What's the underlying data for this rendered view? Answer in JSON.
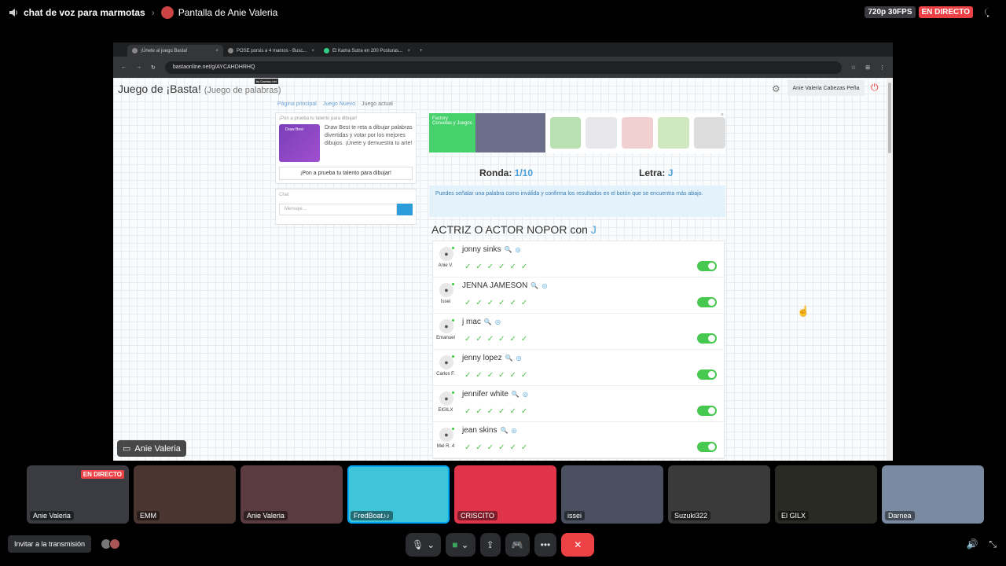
{
  "topbar": {
    "channel": "chat de voz para marmotas",
    "stream_title": "Pantalla de Anie Valeria",
    "quality": "720p 30FPS",
    "live": "EN DIRECTO"
  },
  "browser": {
    "tabs": [
      "¡Únete al juego Basta!",
      "POSE porsis a 4 mamos - Busc...",
      "El Kama Sutra en 200 Posturas..."
    ],
    "url": "bastaonline.net/g/AYCAHDHRHQ"
  },
  "game": {
    "title": "Juego de ¡Basta!",
    "subtitle": "(Juego de palabras)",
    "by": "by Gamiac.net",
    "user": "Anie Valeria Cabezas Peña",
    "breadcrumb": [
      "Página principal",
      "Juego Nuevo",
      "Juego actual"
    ],
    "promo_header": "¡Pon a prueba tu talento para dibujar!",
    "promo_img_label": "Draw Best",
    "promo_text": "Draw Best te reta a dibujar palabras divertidas y votar por los mejores dibujos. ¡Únete y demuestra tu arte!",
    "promo_button": "¡Pon a prueba tu talento para dibujar!",
    "chat_label": "Chat",
    "chat_placeholder": "Mensaje...",
    "ad_brand": "Factory",
    "ad_text": "Consolas y Juegos",
    "ronda_label": "Ronda:",
    "ronda_value": "1/10",
    "letra_label": "Letra:",
    "letra_value": "J",
    "info": "Puedes señalar una palabra como inválida y confirma los resultados en el botón que se encuentra más abajo.",
    "category": "ACTRIZ O ACTOR NOPOR con",
    "category_letter": "J",
    "answers": [
      {
        "word": "jonny sinks",
        "who": "Anie V."
      },
      {
        "word": "JENNA JAMESON",
        "who": "Issei"
      },
      {
        "word": "j mac",
        "who": "Emanuel"
      },
      {
        "word": "jenny lopez",
        "who": "Carlos F."
      },
      {
        "word": "jennifer white",
        "who": "ElGILX"
      },
      {
        "word": "jean skins",
        "who": "Mel R. 4"
      }
    ],
    "checks": "✓✓✓✓✓✓"
  },
  "screen_label": "Anie Valeria",
  "tiles": [
    {
      "name": "Anie Valeria",
      "live": "EN DIRECTO",
      "bg": "#3a3c42"
    },
    {
      "name": "EMM",
      "bg": "#4a3530"
    },
    {
      "name": "Anie Valeria",
      "bg": "#5a3b40"
    },
    {
      "name": "FredBoat♪♪",
      "bg": "#3ec6d8"
    },
    {
      "name": "CRISCITO",
      "bg": "#e0344a"
    },
    {
      "name": "issei",
      "bg": "#4a5060"
    },
    {
      "name": "Suzuki322",
      "bg": "#3a3a3a"
    },
    {
      "name": "El GILX",
      "bg": "#2a2a24"
    },
    {
      "name": "Darnea",
      "bg": "#7a8aa0"
    }
  ],
  "bottom": {
    "invite": "Invitar a la transmisión"
  },
  "colors": {
    "live": "#ed4245",
    "accent": "#4a9fd8",
    "toggle": "#47c84f"
  }
}
